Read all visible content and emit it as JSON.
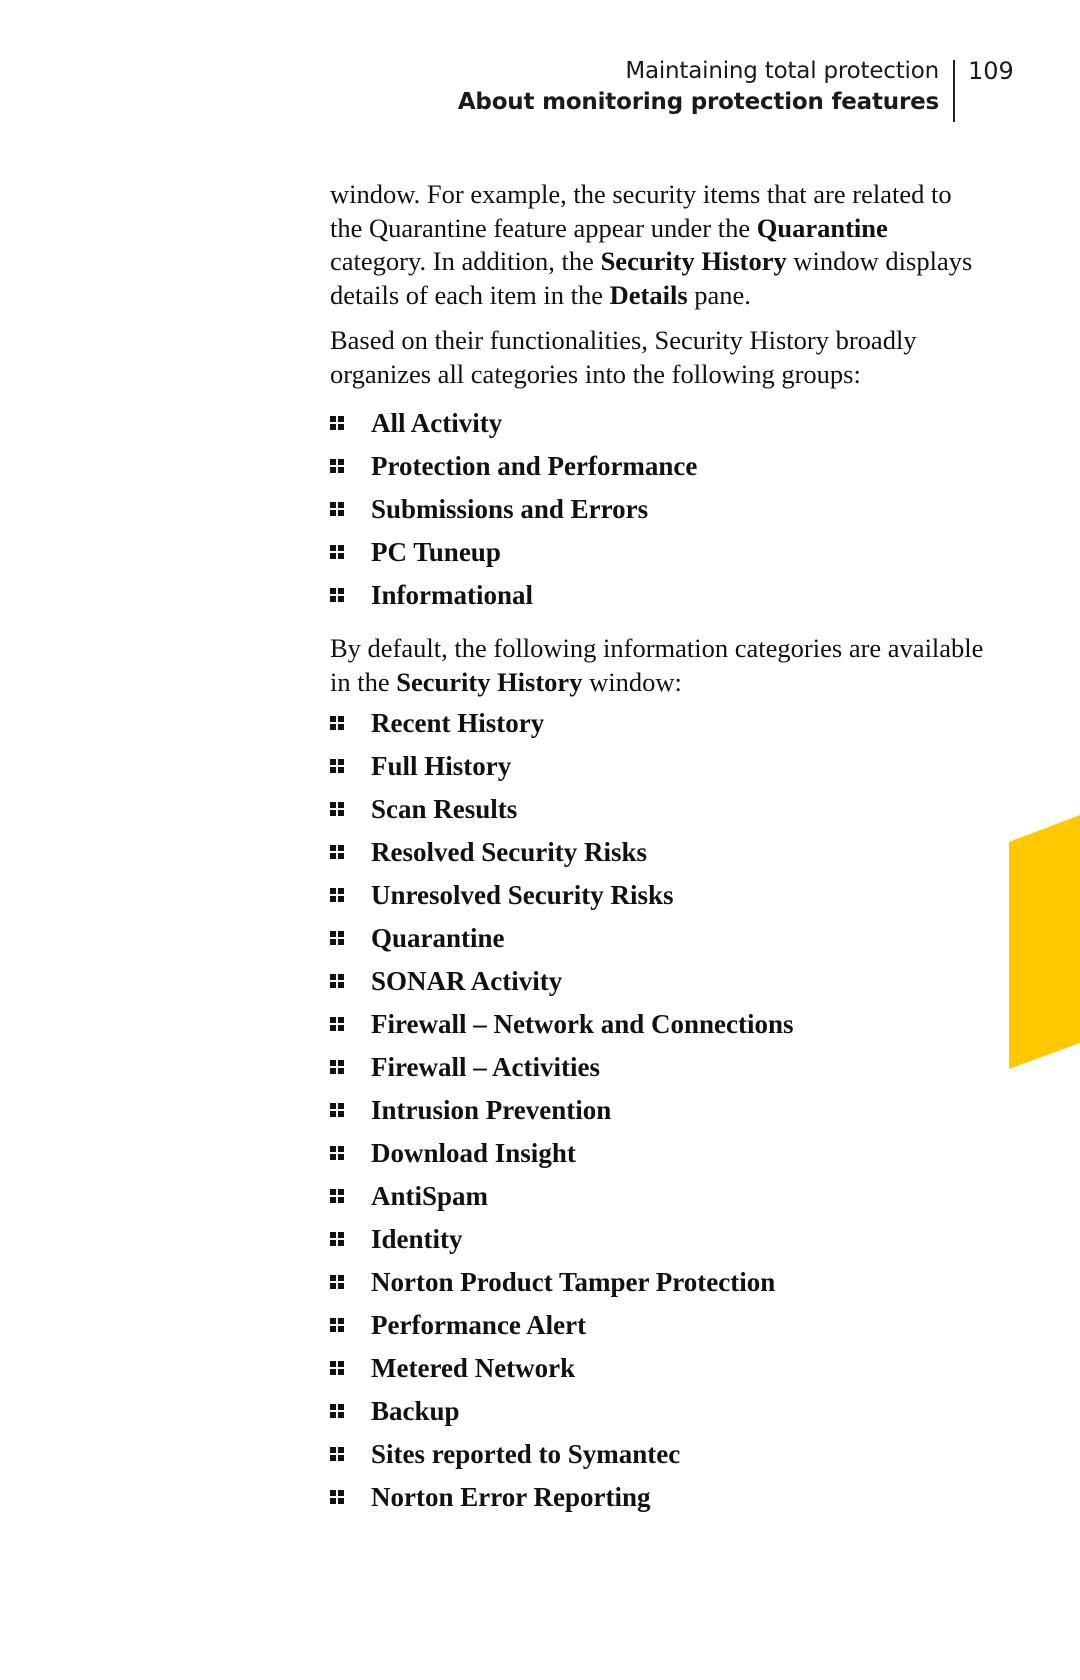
{
  "header": {
    "chapter_title": "Maintaining total protection",
    "section_title": "About monitoring protection features",
    "page_number": "109"
  },
  "intro_paragraph": {
    "segments": [
      {
        "text": "window. For example, the security items that are related to the Quarantine feature appear under the ",
        "bold": false
      },
      {
        "text": "Quarantine",
        "bold": true
      },
      {
        "text": " category. In addition, the ",
        "bold": false
      },
      {
        "text": "Security History",
        "bold": true
      },
      {
        "text": " window displays details of each item in the ",
        "bold": false
      },
      {
        "text": "Details",
        "bold": true
      },
      {
        "text": " pane.",
        "bold": false
      }
    ]
  },
  "groups_paragraph": {
    "segments": [
      {
        "text": "Based on their functionalities, Security History broadly organizes all categories into the following groups:",
        "bold": false
      }
    ]
  },
  "groups": [
    "All Activity",
    "Protection and Performance",
    "Submissions and Errors",
    "PC Tuneup",
    "Informational"
  ],
  "categories_paragraph": {
    "segments": [
      {
        "text": "By default, the following information categories are available in the ",
        "bold": false
      },
      {
        "text": "Security History",
        "bold": true
      },
      {
        "text": " window:",
        "bold": false
      }
    ]
  },
  "categories": [
    "Recent History",
    "Full History",
    "Scan Results",
    "Resolved Security Risks",
    "Unresolved Security Risks",
    "Quarantine",
    "SONAR Activity",
    "Firewall – Network and Connections",
    "Firewall – Activities",
    "Intrusion Prevention",
    "Download Insight",
    "AntiSpam",
    "Identity",
    "Norton Product Tamper Protection",
    "Performance Alert",
    "Metered Network",
    "Backup",
    "Sites reported to Symantec",
    "Norton Error Reporting"
  ],
  "colors": {
    "accent_tab": "#FFC800",
    "text": "#111111"
  }
}
